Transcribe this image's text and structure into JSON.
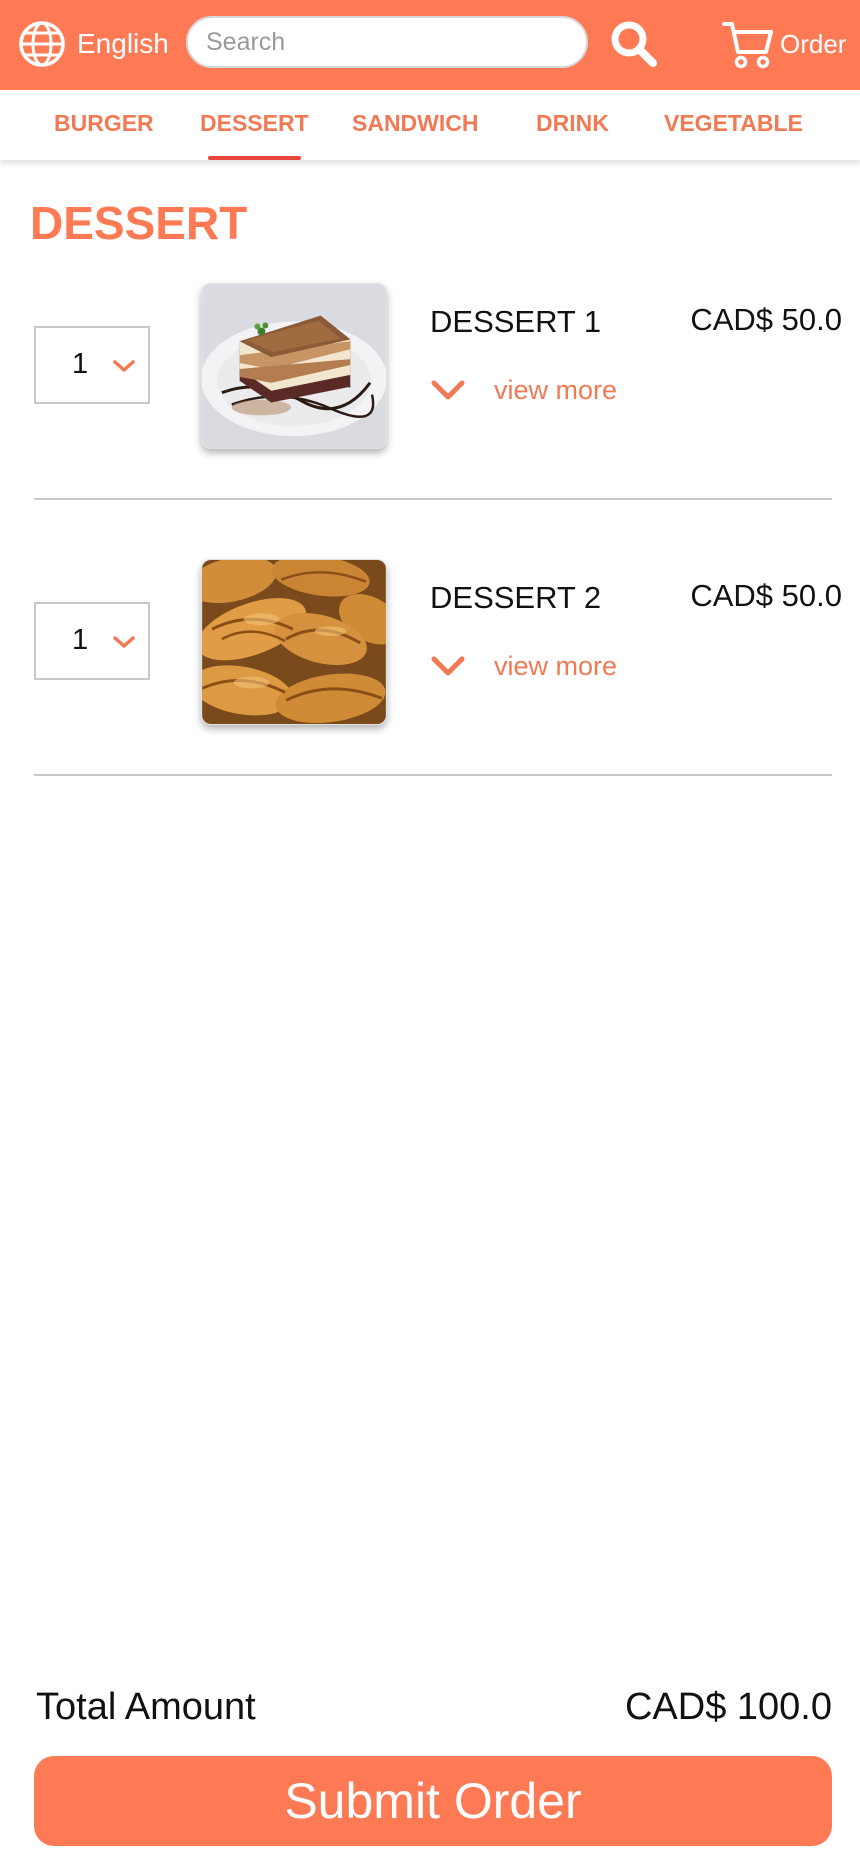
{
  "header": {
    "language_label": "English",
    "language_icon": "globe-icon",
    "search_placeholder": "Search",
    "search_value": "",
    "search_icon": "search-icon",
    "order_label": "Order",
    "order_icon": "cart-icon"
  },
  "tabs": [
    {
      "label": "BURGER",
      "active": false
    },
    {
      "label": "DESSERT",
      "active": true
    },
    {
      "label": "SANDWICH",
      "active": false
    },
    {
      "label": "DRINK",
      "active": false
    },
    {
      "label": "VEGETABLE",
      "active": false
    }
  ],
  "section": {
    "title": "DESSERT"
  },
  "items": [
    {
      "quantity": "1",
      "name": "DESSERT 1",
      "price": "CAD$ 50.0",
      "view_more": "view more",
      "image": "layered-cake-photo"
    },
    {
      "quantity": "1",
      "name": "DESSERT 2",
      "price": "CAD$ 50.0",
      "view_more": "view more",
      "image": "croissants-photo"
    }
  ],
  "footer": {
    "total_label": "Total Amount",
    "total_value": "CAD$ 100.0",
    "submit_label": "Submit Order"
  },
  "colors": {
    "accent": "#fe7a55",
    "tab_text": "#f17a55",
    "tab_underline": "#e8463c"
  }
}
